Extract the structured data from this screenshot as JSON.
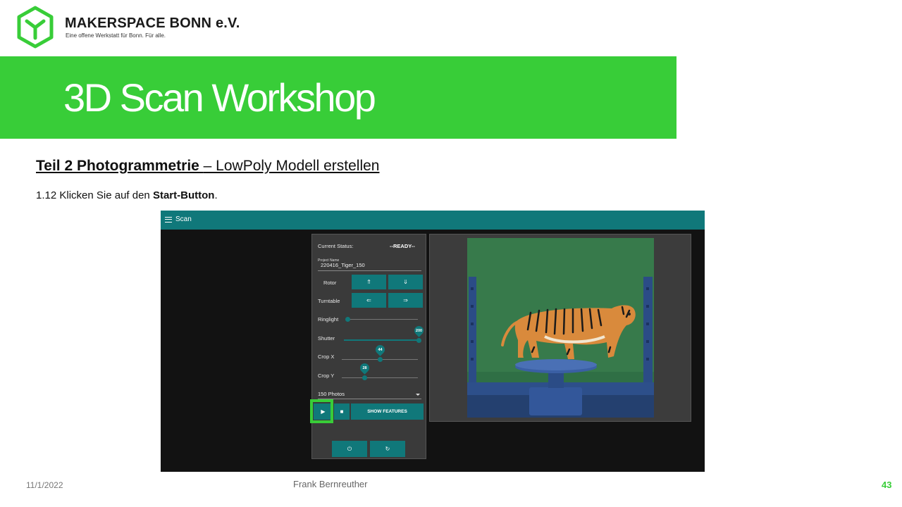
{
  "logo": {
    "name": "MAKERSPACE BONN e.V.",
    "tagline": "Eine offene Werkstatt für Bonn. Für alle.",
    "icon": "hexagon-m-logo-icon",
    "color": "#38cd38"
  },
  "banner": {
    "title": "3D Scan Workshop",
    "color": "#38cd38"
  },
  "subtitle": {
    "bold": "Teil 2  Photogrammetrie ",
    "rest": " – LowPoly Modell erstellen"
  },
  "instruction": {
    "prefix": "1.12 Klicken Sie auf den ",
    "bold": "Start-Button",
    "suffix": "."
  },
  "app": {
    "title": "Scan",
    "menu_icon": "menu-icon",
    "accent": "#10787a",
    "panel": {
      "status_label": "Current Status:",
      "status_value": "--READY--",
      "project_name_label": "Project Name",
      "project_name_value": "220416_Tiger_150",
      "rotor_label": "Rotor",
      "rotor_up": "⇑",
      "rotor_down": "⇓",
      "turntable_label": "Turntable",
      "turntable_left": "⇐",
      "turntable_right": "⇒",
      "ringlight_label": "Ringlight",
      "shutter_label": "Shutter",
      "shutter_value": "200",
      "cropx_label": "Crop X",
      "cropx_value": "44",
      "cropy_label": "Crop Y",
      "cropy_value": "28",
      "photos_select": "150 Photos",
      "play_icon": "▶",
      "stop_icon": "■",
      "show_features": "SHOW FEATURES",
      "power_icon": "⏻",
      "reload_icon": "↻"
    },
    "sliders": {
      "ringlight": 0.0,
      "shutter": 1.0,
      "cropx": 0.5,
      "cropy": 0.3
    },
    "preview_icon": "tiger-photo-icon"
  },
  "footer": {
    "date": "11/1/2022",
    "author": "Frank Bernreuther",
    "page": "43"
  }
}
